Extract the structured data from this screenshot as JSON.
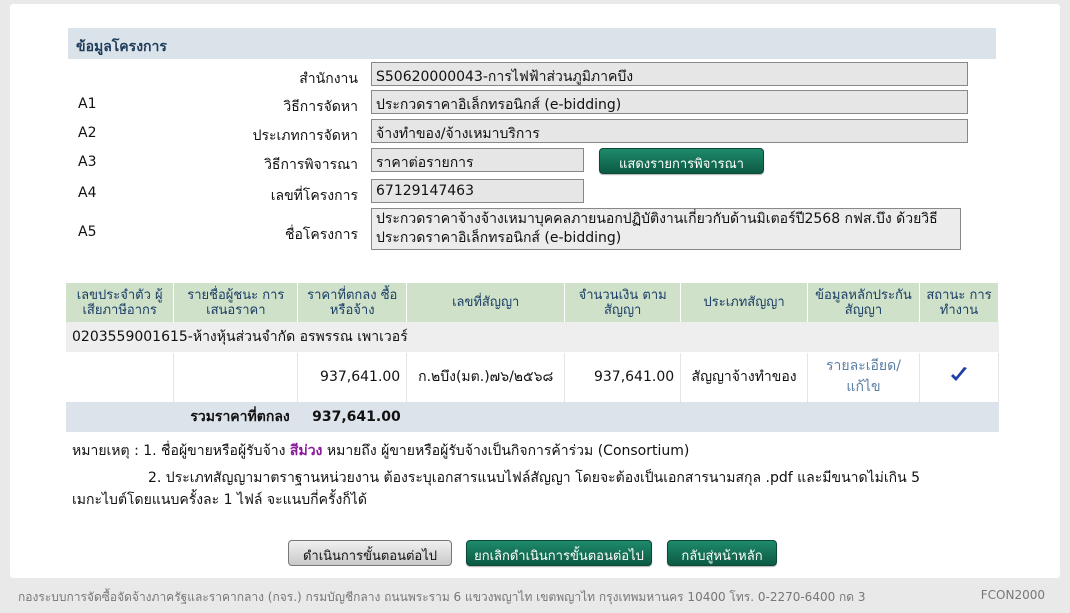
{
  "section_title": "ข้อมูลโครงการ",
  "fields": [
    {
      "code": "",
      "label": "สำนักงาน",
      "value": "S50620000043-การไฟฟ้าส่วนภูมิภาคบึง"
    },
    {
      "code": "A1",
      "label": "วิธีการจัดหา",
      "value": "ประกวดราคาอิเล็กทรอนิกส์ (e-bidding)"
    },
    {
      "code": "A2",
      "label": "ประเภทการจัดหา",
      "value": "จ้างทำของ/จ้างเหมาบริการ"
    },
    {
      "code": "A3",
      "label": "วิธีการพิจารณา",
      "value": "ราคาต่อรายการ"
    },
    {
      "code": "A4",
      "label": "เลขที่โครงการ",
      "value": "67129147463"
    },
    {
      "code": "A5",
      "label": "ชื่อโครงการ",
      "value": "ประกวดราคาจ้างจ้างเหมาบุคคลภายนอกปฏิบัติงานเกี่ยวกับด้านมิเตอร์ปี2568 กฟส.บึง ด้วยวิธีประกวดราคาอิเล็กทรอนิกส์ (e-bidding)"
    }
  ],
  "show_items_button": "แสดงรายการพิจารณา",
  "table": {
    "headers": [
      "เลขประจำตัว ผู้เสียภาษีอากร",
      "รายชื่อผู้ชนะ การเสนอราคา",
      "ราคาที่ตกลง ซื้อหรือจ้าง",
      "เลขที่สัญญา",
      "จำนวนเงิน ตามสัญญา",
      "ประเภทสัญญา",
      "ข้อมูลหลักประกัน สัญญา",
      "สถานะ การทำงาน"
    ],
    "group_label": "0203559001615-ห้างหุ้นส่วนจำกัด อรพรรณ เพาเวอร์",
    "row": {
      "agreed_price": "937,641.00",
      "contract_no": "ก.๒บึง(มต.)๗๖/๒๕๖๘",
      "contract_amount": "937,641.00",
      "contract_type": "สัญญาจ้างทำของ",
      "guarantee_link": "รายละเอียด/ แก้ไข"
    },
    "total_label": "รวมราคาที่ตกลง",
    "total_value": "937,641.00"
  },
  "notes": {
    "prefix": "หมายเหตุ : 1. ชื่อผู้ขายหรือผู้รับจ้าง",
    "purple": "สีม่วง",
    "suffix": "หมายถึง ผู้ขายหรือผู้รับจ้างเป็นกิจการค้าร่วม (Consortium)",
    "line2": "2. ประเภทสัญญามาตราฐานหน่วยงาน ต้องระบุเอกสารแนบไฟล์สัญญา โดยจะต้องเป็นเอกสารนามสกุล .pdf และมีขนาดไม่เกิน 5",
    "line3": "เมกะไบต์โดยแนบครั้งละ 1 ไฟล์ จะแนบกี่ครั้งก็ได้"
  },
  "buttons": {
    "next": "ดำเนินการขั้นตอนต่อไป",
    "cancel": "ยกเลิกดำเนินการขั้นตอนต่อไป",
    "home": "กลับสู่หน้าหลัก"
  },
  "footer": {
    "left": "กองระบบการจัดซื้อจัดจ้างภาครัฐและราคากลาง (กจร.) กรมบัญชีกลาง ถนนพระราม 6 แขวงพญาไท เขตพญาไท กรุงเทพมหานคร 10400 โทร. 0-2270-6400 กด 3",
    "right": "FCON2000"
  },
  "colors": {
    "accent_green": "#0f6b50",
    "purple_note": "#8a1a9a",
    "header_bg": "#cfe2c9"
  },
  "icons": {
    "status": "checkmark-icon"
  }
}
